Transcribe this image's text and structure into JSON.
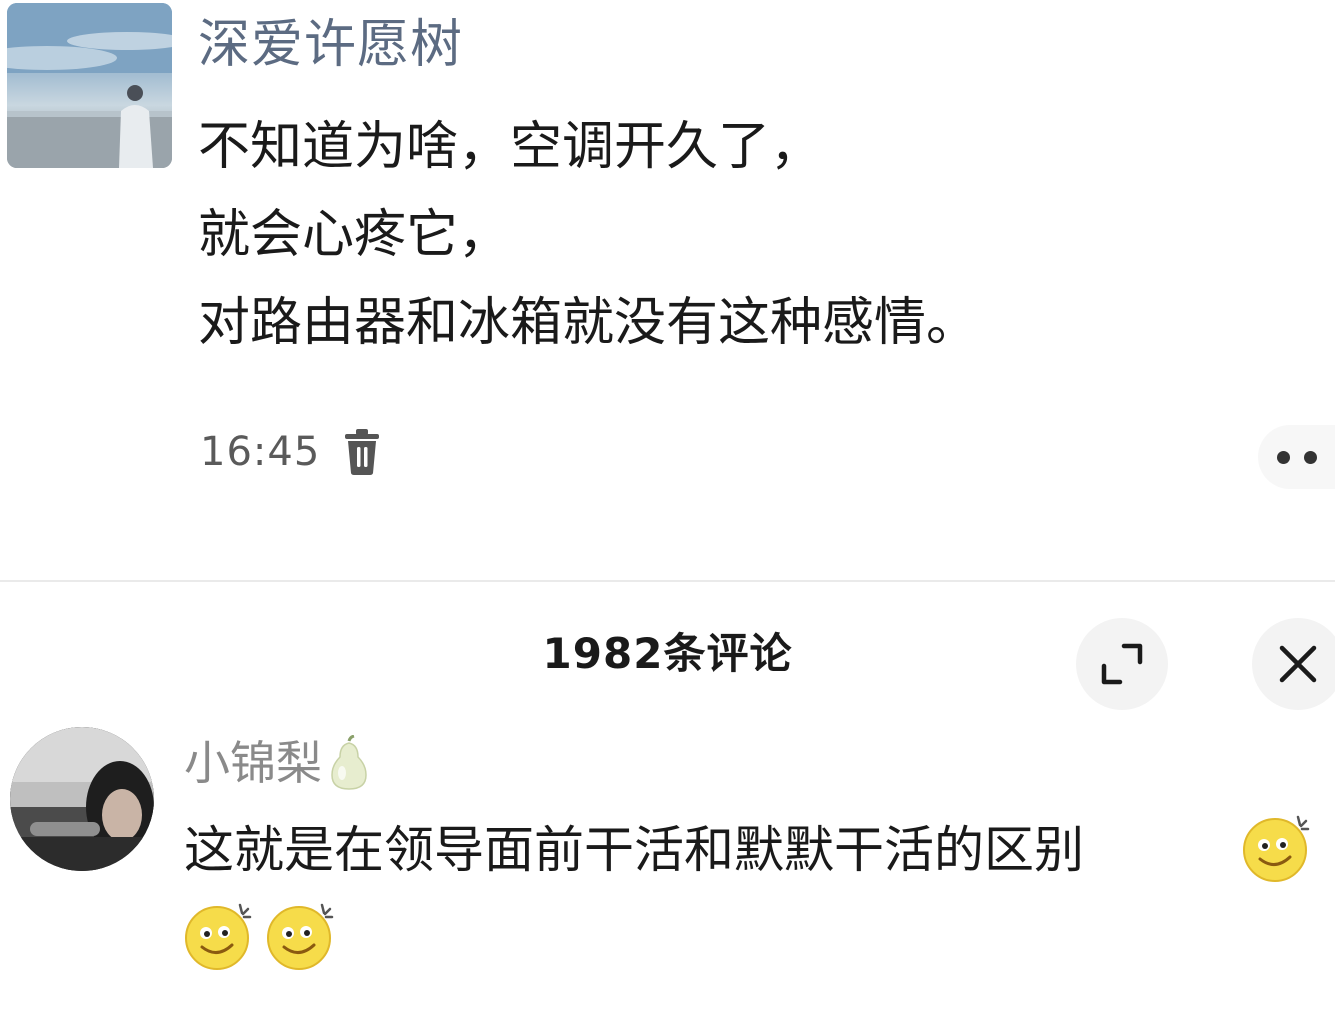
{
  "post": {
    "author": "深爱许愿树",
    "lines": [
      "不知道为啥，空调开久了，",
      "就会心疼它，",
      "对路由器和冰箱就没有这种感情。"
    ],
    "time": "16:45"
  },
  "comments_panel": {
    "title": "1982条评论",
    "comment": {
      "author": "小锦梨",
      "text": "这就是在领导面前干活和默默干活的区别"
    }
  }
}
